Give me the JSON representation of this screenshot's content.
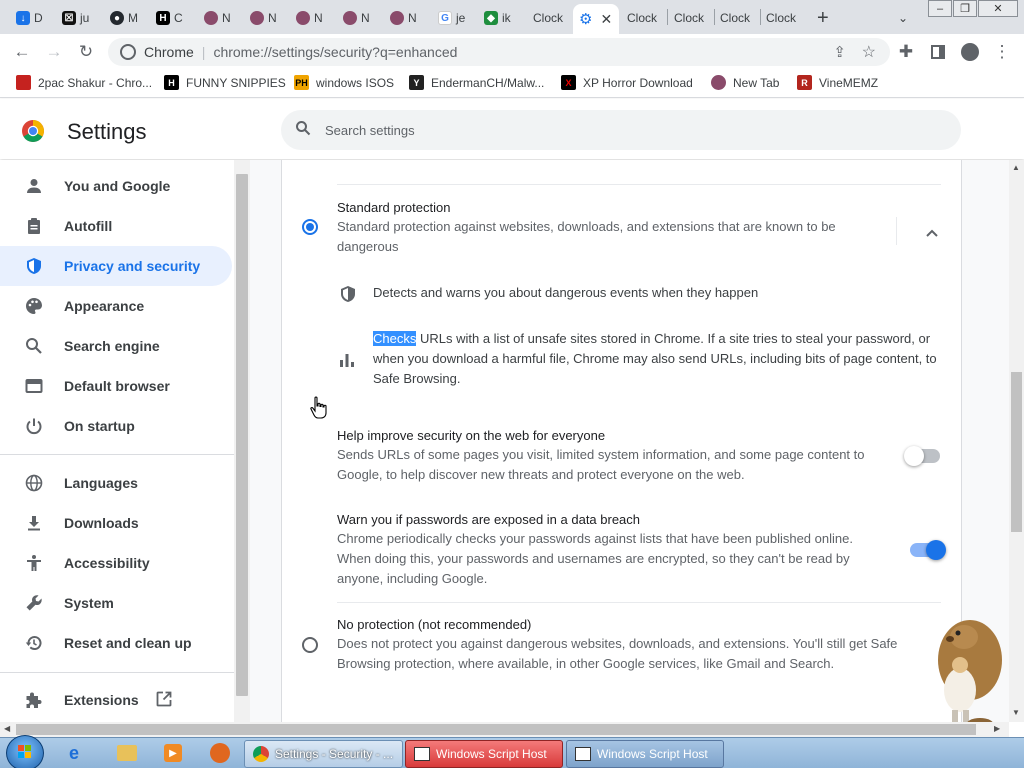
{
  "tabs": [
    {
      "label": "D",
      "icon": "download-icon"
    },
    {
      "label": "ju",
      "icon": "jupyter-icon"
    },
    {
      "label": "M",
      "icon": "github-icon"
    },
    {
      "label": "C",
      "icon": "h-logo-icon"
    },
    {
      "label": "N",
      "icon": "avatar-icon"
    },
    {
      "label": "N",
      "icon": "avatar-icon"
    },
    {
      "label": "N",
      "icon": "avatar-icon"
    },
    {
      "label": "N",
      "icon": "avatar-icon"
    },
    {
      "label": "N",
      "icon": "avatar-icon"
    },
    {
      "label": "je",
      "icon": "google-icon"
    },
    {
      "label": "ik",
      "icon": "app-icon"
    },
    {
      "label": "Clock",
      "icon": ""
    },
    {
      "label": "",
      "icon": "settings-gear-icon",
      "active": true
    },
    {
      "label": "Clock",
      "icon": ""
    },
    {
      "label": "Clock",
      "icon": ""
    },
    {
      "label": "Clock",
      "icon": ""
    },
    {
      "label": "Clock",
      "icon": ""
    }
  ],
  "toolbar": {
    "site_label": "Chrome",
    "url": "chrome://settings/security?q=enhanced"
  },
  "bookmarks": [
    {
      "label": "2pac Shakur - Chro...",
      "icon": "bookmark-favicon"
    },
    {
      "label": "FUNNY SNIPPIES",
      "icon": "h-logo-icon"
    },
    {
      "label": "windows ISOS",
      "icon": "ph-icon"
    },
    {
      "label": "EndermanCH/Malw...",
      "icon": "yp-icon"
    },
    {
      "label": "XP Horror Download",
      "icon": "x-icon"
    },
    {
      "label": "New Tab",
      "icon": "avatar-icon"
    },
    {
      "label": "VineMEMZ",
      "icon": "r-icon"
    }
  ],
  "header": {
    "title": "Settings",
    "search_placeholder": "Search settings"
  },
  "sidebar": {
    "items": [
      {
        "label": "You and Google",
        "icon": "person-icon"
      },
      {
        "label": "Autofill",
        "icon": "clipboard-icon"
      },
      {
        "label": "Privacy and security",
        "icon": "shield-icon",
        "selected": true
      },
      {
        "label": "Appearance",
        "icon": "palette-icon"
      },
      {
        "label": "Search engine",
        "icon": "search-icon"
      },
      {
        "label": "Default browser",
        "icon": "browser-icon"
      },
      {
        "label": "On startup",
        "icon": "power-icon"
      },
      {
        "label": "Languages",
        "icon": "globe-icon"
      },
      {
        "label": "Downloads",
        "icon": "download-icon"
      },
      {
        "label": "Accessibility",
        "icon": "accessibility-icon"
      },
      {
        "label": "System",
        "icon": "wrench-icon"
      },
      {
        "label": "Reset and clean up",
        "icon": "history-icon"
      },
      {
        "label": "Extensions",
        "icon": "puzzle-icon"
      }
    ]
  },
  "main": {
    "standard": {
      "title": "Standard protection",
      "desc": "Standard protection against websites, downloads, and extensions that are known to be dangerous",
      "selected": true,
      "detail1": "Detects and warns you about dangerous events when they happen",
      "detail2_highlight": "Checks",
      "detail2_rest": " URLs with a list of unsafe sites stored in Chrome. If a site tries to steal your password, or when you download a harmful file, Chrome may also send URLs, including bits of page content, to Safe Browsing."
    },
    "help_improve": {
      "title": "Help improve security on the web for everyone",
      "desc": "Sends URLs of some pages you visit, limited system information, and some page content to Google, to help discover new threats and protect everyone on the web.",
      "enabled": false
    },
    "password_warn": {
      "title": "Warn you if passwords are exposed in a data breach",
      "desc": "Chrome periodically checks your passwords against lists that have been published online. When doing this, your passwords and usernames are encrypted, so they can't be read by anyone, including Google.",
      "enabled": true
    },
    "no_protection": {
      "title": "No protection (not recommended)",
      "desc": "Does not protect you against dangerous websites, downloads, and extensions. You'll still get Safe Browsing protection, where available, in other Google services, like Gmail and Search.",
      "selected": false
    }
  },
  "taskbar": {
    "tasks": [
      {
        "label": "Settings - Security - ...",
        "icon": "chrome-icon"
      },
      {
        "label": "Windows Script Host",
        "icon": "script-icon"
      },
      {
        "label": "Windows Script Host",
        "icon": "script-icon"
      }
    ]
  },
  "colors": {
    "accent": "#1a73e8",
    "selected_bg": "#e8f0fe",
    "highlight": "#3390ff"
  }
}
